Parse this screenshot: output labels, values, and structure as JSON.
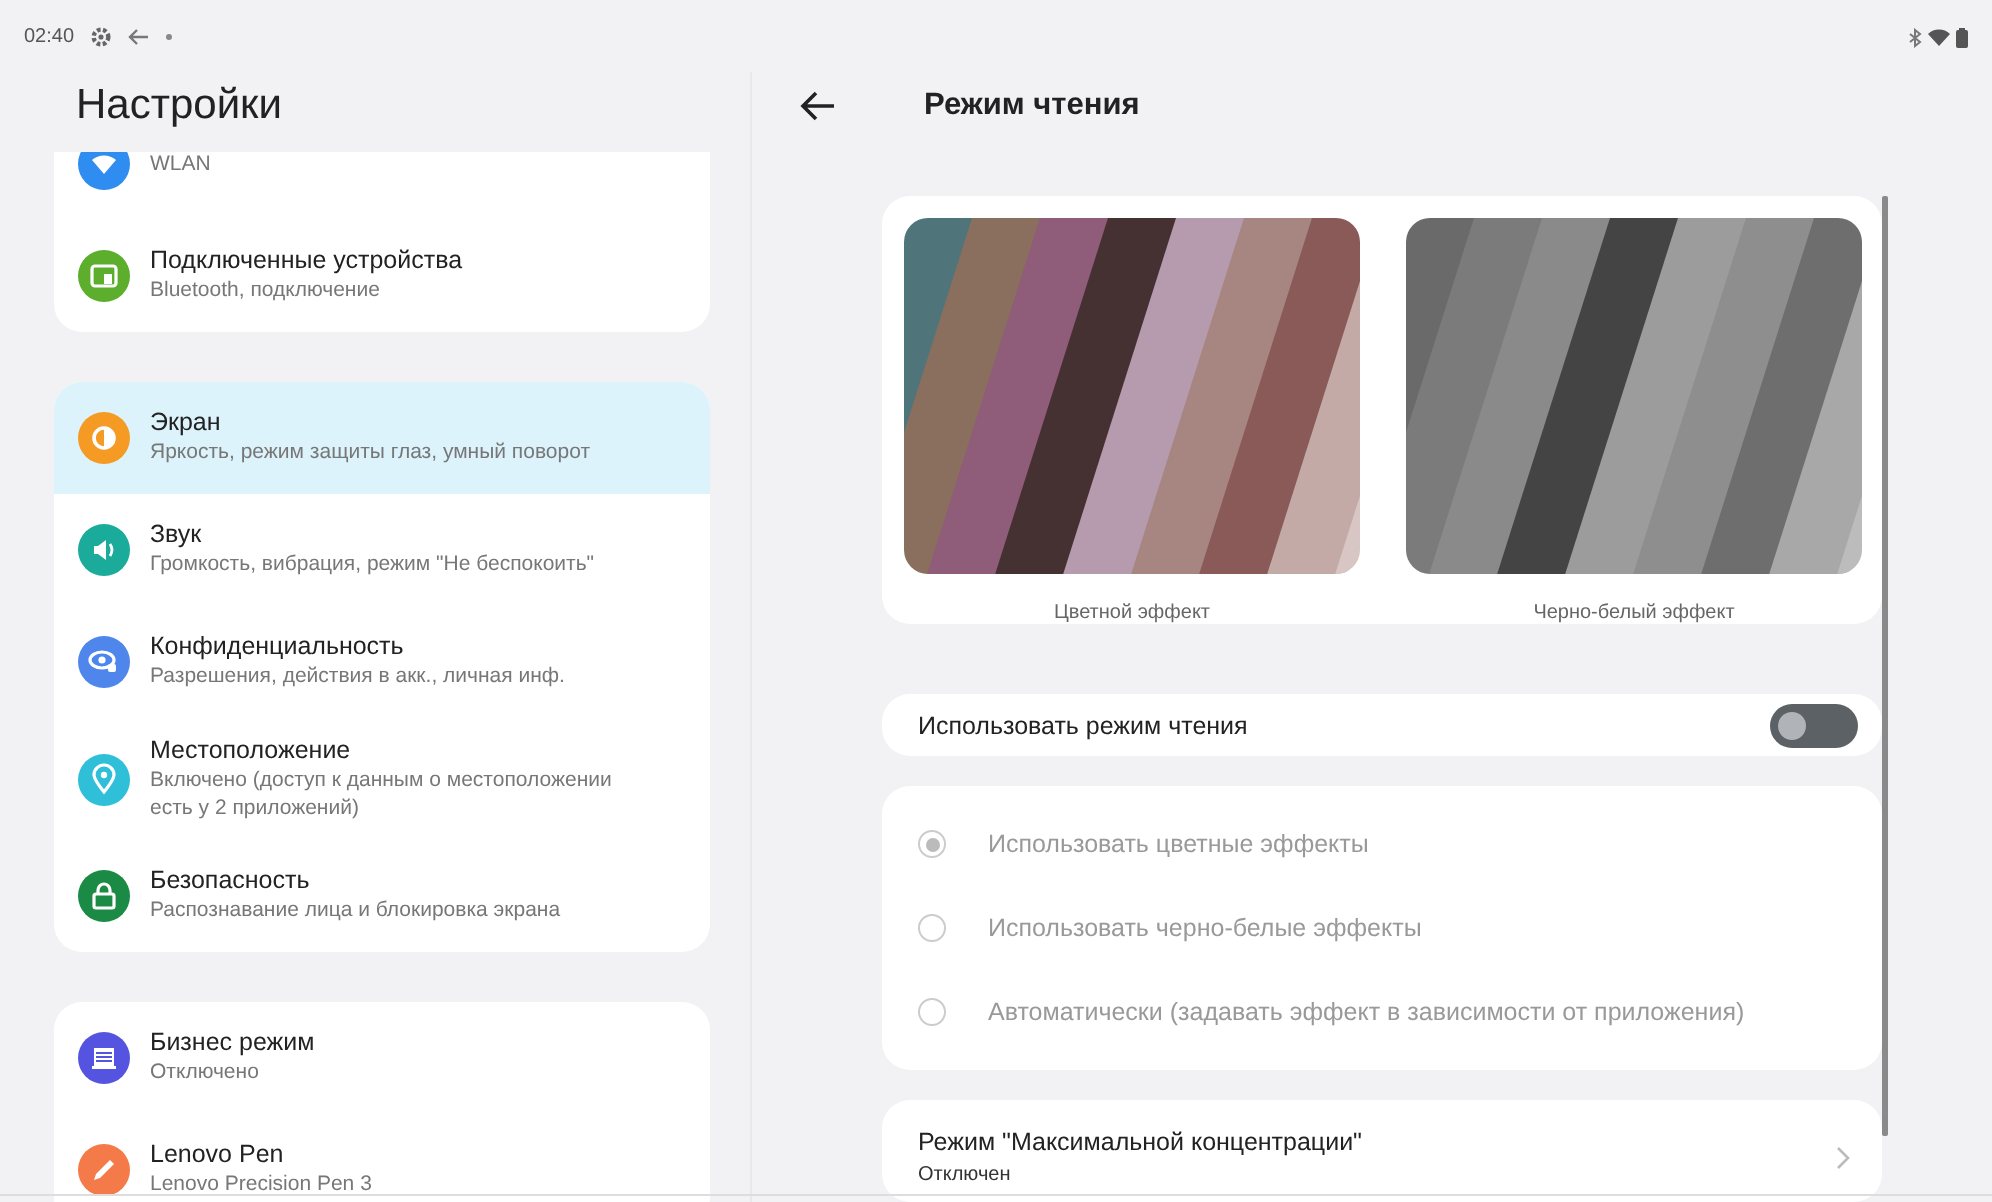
{
  "status_bar": {
    "time": "02:40"
  },
  "sidebar": {
    "title": "Настройки",
    "groups": [
      {
        "items": [
          {
            "subtitle": "WLAN",
            "color": "#2f8cf0",
            "selected": false
          },
          {
            "title": "Подключенные устройства",
            "subtitle": "Bluetooth, подключение",
            "color": "#5cae2c",
            "selected": false
          }
        ]
      },
      {
        "items": [
          {
            "title": "Экран",
            "subtitle": "Яркость, режим защиты глаз, умный поворот",
            "color": "#f59a23",
            "selected": true
          },
          {
            "title": "Звук",
            "subtitle": "Громкость, вибрация, режим \"Не беспокоить\"",
            "color": "#1aab9b",
            "selected": false
          },
          {
            "title": "Конфиденциальность",
            "subtitle": "Разрешения, действия в акк., личная инф.",
            "color": "#4e86ec",
            "selected": false
          },
          {
            "title": "Местоположение",
            "subtitle": "Включено (доступ к данным о местоположении есть у 2 приложений)",
            "color": "#2fbfd8",
            "selected": false
          },
          {
            "title": "Безопасность",
            "subtitle": "Распознавание лица и блокировка экрана",
            "color": "#1a8a45",
            "selected": false
          }
        ]
      },
      {
        "items": [
          {
            "title": "Бизнес режим",
            "subtitle": "Отключено",
            "color": "#5454e0",
            "selected": false
          },
          {
            "title": "Lenovo Pen",
            "subtitle": "Lenovo Precision Pen 3",
            "color": "#f47a4a",
            "selected": false
          }
        ]
      }
    ]
  },
  "detail": {
    "title": "Режим чтения",
    "previews": [
      {
        "caption": "Цветной эффект"
      },
      {
        "caption": "Черно-белый эффект"
      }
    ],
    "toggle": {
      "label": "Использовать режим чтения",
      "on": false
    },
    "radio_group": {
      "disabled": true,
      "options": [
        {
          "label": "Использовать цветные эффекты",
          "selected": true
        },
        {
          "label": "Использовать черно-белые эффекты",
          "selected": false
        },
        {
          "label": "Автоматически (задавать эффект в зависимости от приложения)",
          "selected": false
        }
      ]
    },
    "concentration": {
      "title": "Режим \"Максимальной концентрации\"",
      "subtitle": "Отключен"
    }
  }
}
